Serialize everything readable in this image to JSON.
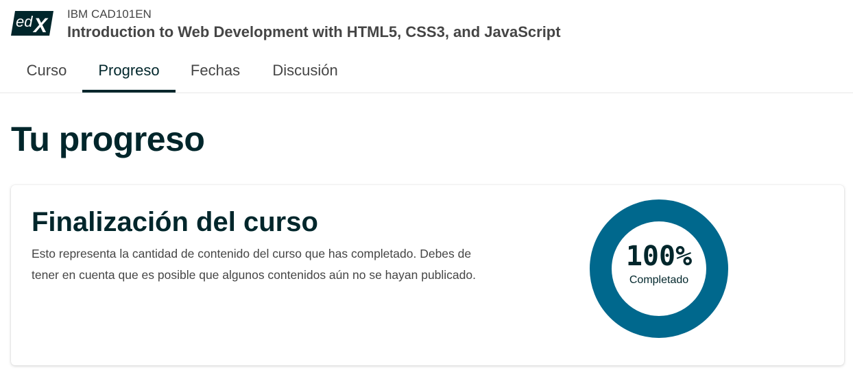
{
  "header": {
    "logo_text": "edX",
    "course_code": "IBM CAD101EN",
    "course_title": "Introduction to Web Development with HTML5, CSS3, and JavaScript"
  },
  "tabs": [
    {
      "label": "Curso",
      "active": false
    },
    {
      "label": "Progreso",
      "active": true
    },
    {
      "label": "Fechas",
      "active": false
    },
    {
      "label": "Discusión",
      "active": false
    }
  ],
  "page": {
    "title": "Tu progreso"
  },
  "completion_card": {
    "title": "Finalización del curso",
    "description": "Esto representa la cantidad de contenido del curso que has completado. Debes de tener en cuenta que es posible que algunos contenidos aún no se hayan publicado.",
    "percent_text": "100%",
    "percent_value": 100,
    "percent_label": "Completado"
  },
  "colors": {
    "brand_dark": "#00262b",
    "progress_ring": "#00688d",
    "text_gray": "#454545"
  }
}
